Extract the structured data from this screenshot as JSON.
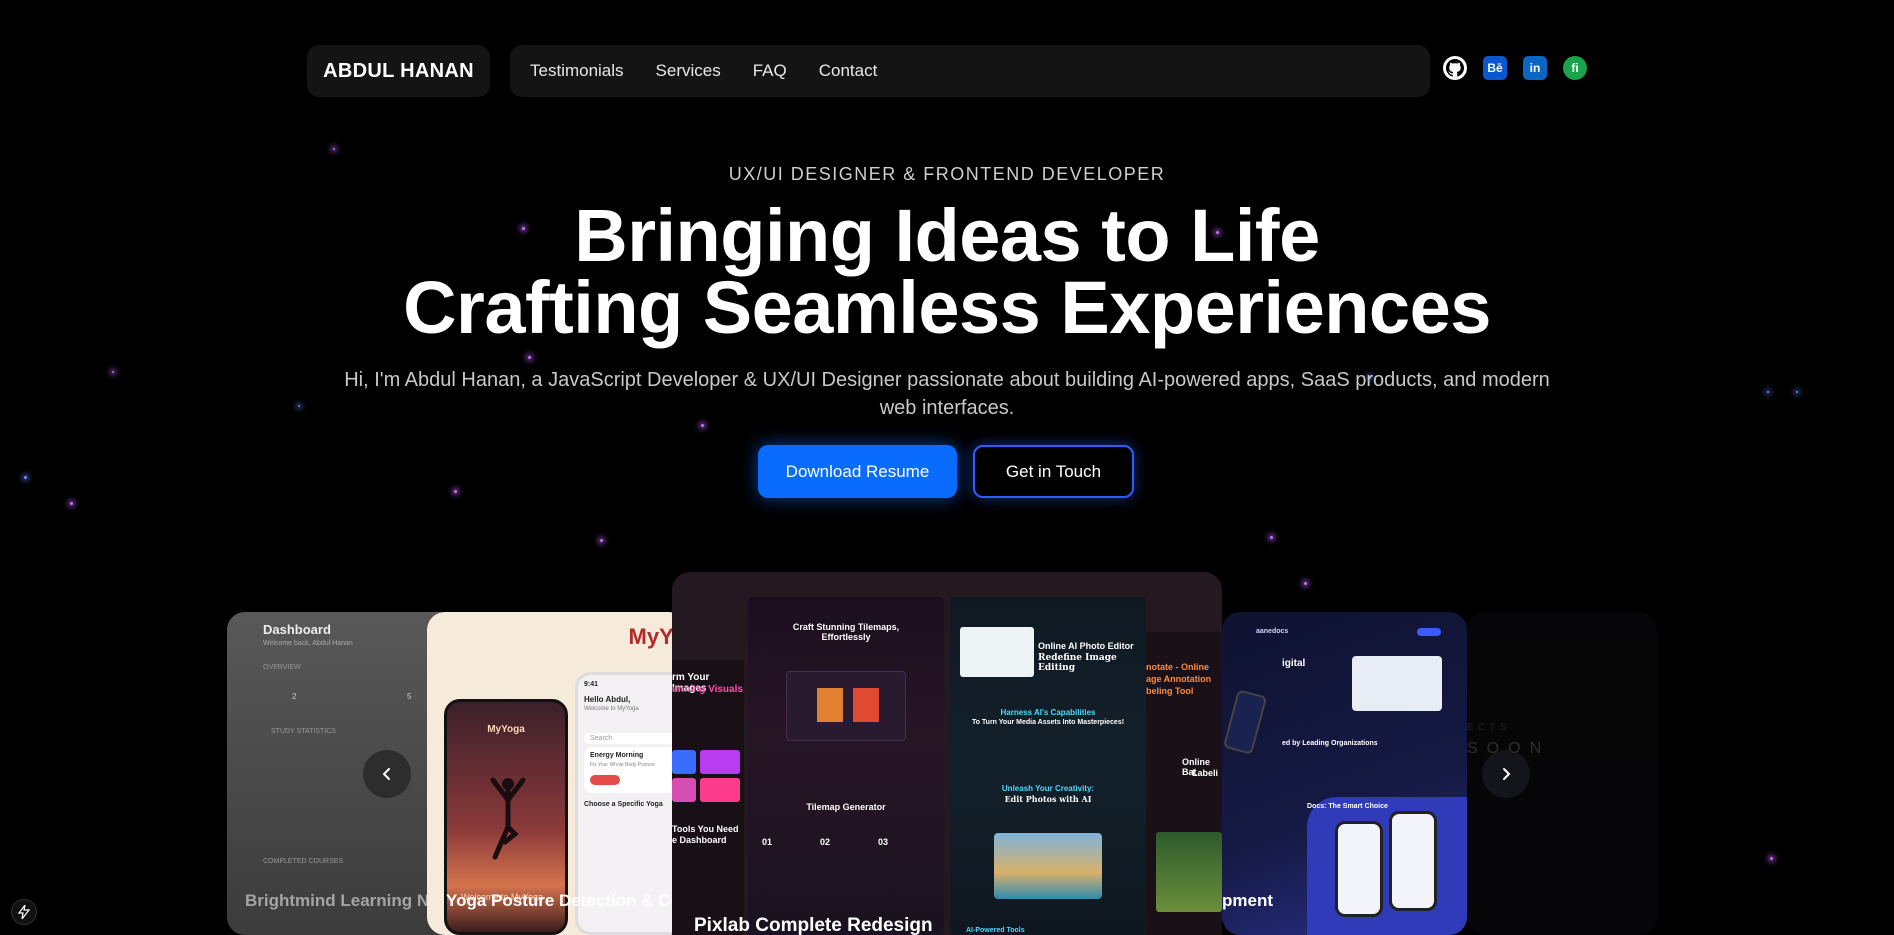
{
  "nav": {
    "brand": "ABDUL HANAN",
    "links": [
      "Testimonials",
      "Services",
      "FAQ",
      "Contact"
    ],
    "socials": [
      {
        "icon": "github-icon",
        "glyph": "●"
      },
      {
        "icon": "behance-icon",
        "glyph": "Bē"
      },
      {
        "icon": "linkedin-icon",
        "glyph": "in"
      },
      {
        "icon": "fiverr-icon",
        "glyph": "fi"
      }
    ]
  },
  "hero": {
    "eyebrow": "UX/UI DESIGNER & FRONTEND DEVELOPER",
    "headline_line1": "Bringing Ideas to Life",
    "headline_line2": "Crafting Seamless Experiences",
    "subtitle": "Hi, I'm Abdul Hanan, a JavaScript Developer & UX/UI Designer passionate about building AI-powered apps, SaaS products, and modern web interfaces.",
    "primary_button": "Download Resume",
    "secondary_button": "Get in Touch"
  },
  "carousel": {
    "prev_glyph": "‹",
    "next_glyph": "›",
    "cards": [
      {
        "title": "Brightmind Learning Ne",
        "screen_title": "Dashboard",
        "screen_sub": "Welcome back, Abdul Hanan",
        "overview": "OVERVIEW",
        "study_stats": "STUDY STATISTICS",
        "completed": "COMPLETED COURSES",
        "stat1": "2",
        "stat2": "5"
      },
      {
        "title": "Yoga Posture Detection & Cor",
        "brand": "MyYog",
        "phone_brand": "MyYoga",
        "time": "9:41",
        "greeting": "Hello Abdul,",
        "welcome": "Welcome to MyYoga",
        "search": "Search",
        "energy": "Energy Morning",
        "energy_sub": "Fix Your Whole Body Posture",
        "choose": "Choose a Specific Yoga",
        "welcome_bottom": "Welcome to MyYoga"
      },
      {
        "title": "Pixlab Complete Redesign",
        "left_header": "Craft Stunning Tilemaps, Effortlessly",
        "left_side_1": "rm Your Images",
        "left_side_2": "unning Visuals",
        "tilemap": "Tilemap Generator",
        "steps": [
          "01",
          "02",
          "03"
        ],
        "tools": "Tools You Need",
        "dashboard": "e Dashboard",
        "right_header": "Online AI Photo Editor",
        "right_sub": "Redefine Image Editing",
        "harness": "Harness AI's Capabilities",
        "turn": "To Turn Your Media Assets Into Masterpieces!",
        "unleash": "Unleash Your Creativity:",
        "edit": "Edit Photos with AI",
        "ai_tools": "AI-Powered Tools",
        "side_r_1": "notate - Online",
        "side_r_2": "age Annotation",
        "side_r_3": "beling Tool",
        "side_r_4": "Online Bat",
        "side_r_5": "Labeli"
      },
      {
        "title": "pment",
        "brand": "aanedocs",
        "digital": "igital",
        "trusted": "ed by Leading Organizations",
        "smart": "Docs: The Smart Choice"
      },
      {
        "coming_small": "ECTS",
        "coming": "SOON"
      }
    ]
  },
  "colors": {
    "background": "#000000",
    "primary": "#0a6cff",
    "outline": "#2f5cff",
    "star": "#c86cff"
  }
}
